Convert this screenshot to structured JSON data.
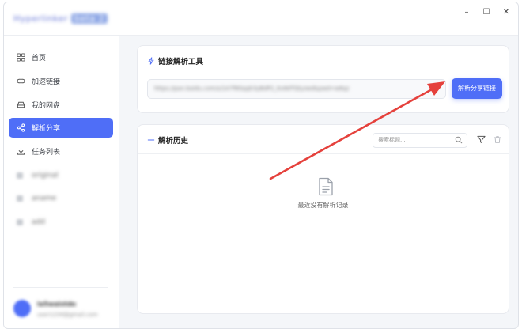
{
  "app": {
    "title": "Hyperlinker",
    "version": "beta 2"
  },
  "window_controls": {
    "minimize": "–",
    "maximize": "☐",
    "close": "✕"
  },
  "sidebar": {
    "items": [
      {
        "label": "首页",
        "icon": "grid-icon"
      },
      {
        "label": "加速链接",
        "icon": "link-icon"
      },
      {
        "label": "我的网盘",
        "icon": "drive-icon"
      },
      {
        "label": "解析分享",
        "icon": "share-icon",
        "active": true
      },
      {
        "label": "任务列表",
        "icon": "download-icon"
      },
      {
        "label": "original"
      },
      {
        "label": "aname"
      },
      {
        "label": "add"
      }
    ],
    "user": {
      "name": "la5waistdo",
      "sub": "user1234@gmail.com"
    }
  },
  "tool_card": {
    "title": "链接解析工具",
    "input_value": "https://pan.baidu.com/s/1A7f8Gqqh3yBdP2_Kx8dTQlyzwd&pwd=w6qz",
    "button_label": "解析分享链接"
  },
  "history_card": {
    "title": "解析历史",
    "search_placeholder": "搜索标题...",
    "empty_text": "最近没有解析记录"
  },
  "colors": {
    "accent": "#4f6ef7",
    "annotation_arrow": "#e5413c"
  }
}
